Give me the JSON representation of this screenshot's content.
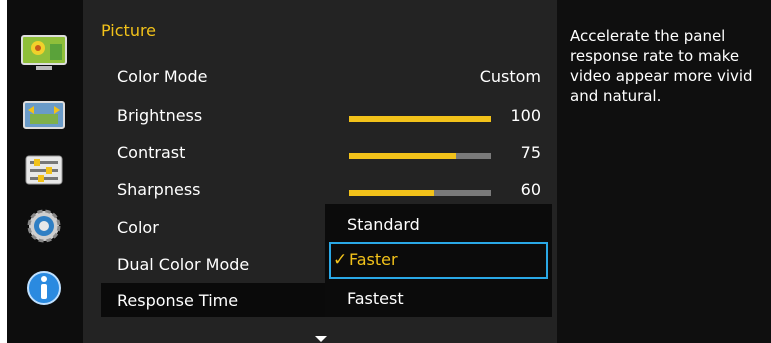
{
  "sidebar": {
    "icons": [
      "picture-icon",
      "onscreen-display-icon",
      "system-icon",
      "settings-icon",
      "information-icon"
    ],
    "active_index": 0
  },
  "menu": {
    "title": "Picture",
    "rows": [
      {
        "label": "Color Mode",
        "value": "Custom"
      },
      {
        "label": "Brightness",
        "value": "100",
        "level": 100
      },
      {
        "label": "Contrast",
        "value": "75",
        "level": 75
      },
      {
        "label": "Sharpness",
        "value": "60",
        "level": 60
      },
      {
        "label": "Color"
      },
      {
        "label": "Dual Color Mode"
      },
      {
        "label": "Response Time"
      }
    ]
  },
  "dropdown": {
    "options": [
      "Standard",
      "Faster",
      "Fastest"
    ],
    "selected": "Faster",
    "check": "✓"
  },
  "description": {
    "text": "Accelerate the panel response rate to make video appear more vivid and natural."
  },
  "colors": {
    "accent": "#f2c21a",
    "focus": "#2aa8e6"
  }
}
